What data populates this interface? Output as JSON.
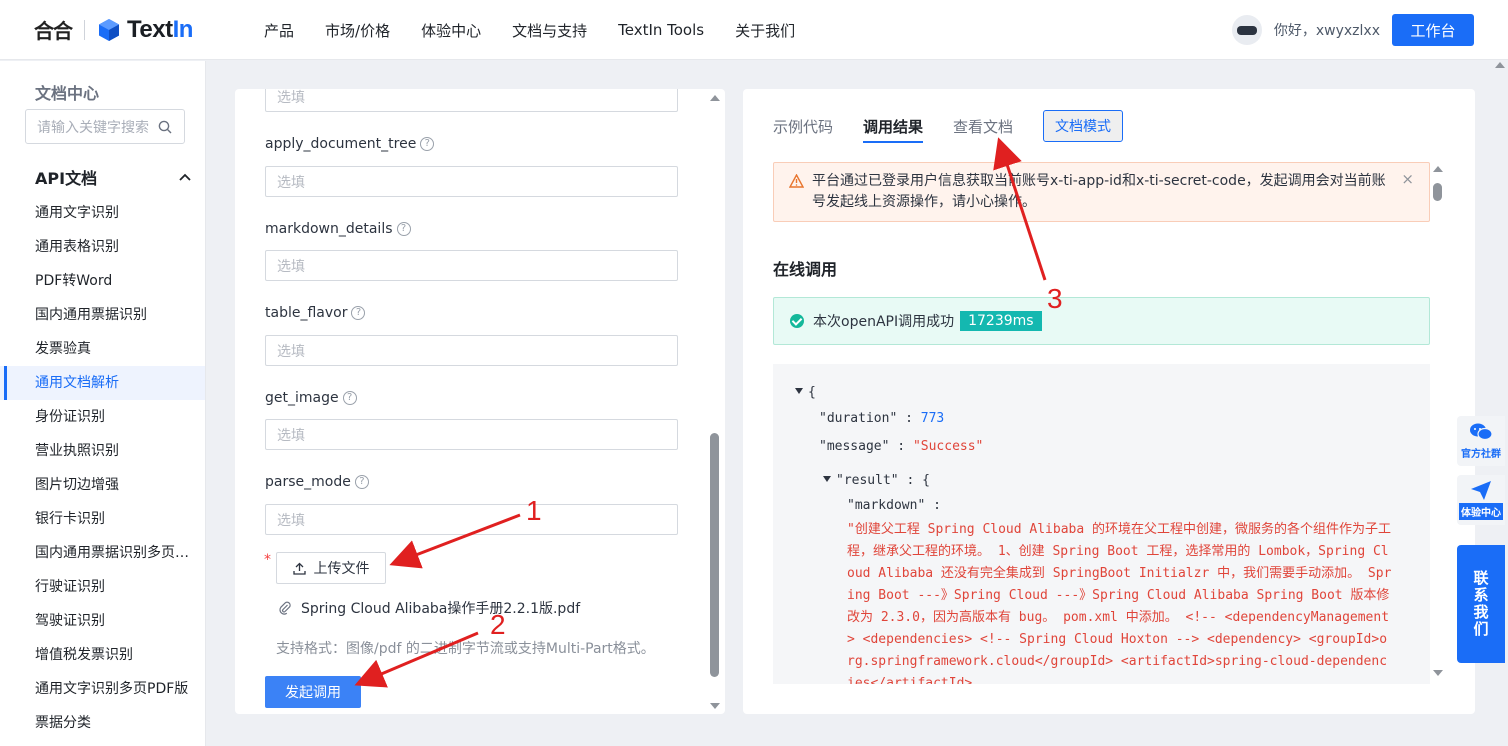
{
  "header": {
    "logo_he": "合合",
    "logo_text_a": "Text",
    "logo_text_b": "In",
    "nav": [
      "产品",
      "市场/价格",
      "体验中心",
      "文档与支持",
      "TextIn Tools",
      "关于我们"
    ],
    "greeting": "你好，xwyxzlxx",
    "workbench_label": "工作台"
  },
  "sidebar": {
    "title": "文档中心",
    "search_placeholder": "请输入关键字搜索",
    "section": "API文档",
    "items": [
      "通用文字识别",
      "通用表格识别",
      "PDF转Word",
      "国内通用票据识别",
      "发票验真",
      "通用文档解析",
      "身份证识别",
      "营业执照识别",
      "图片切边增强",
      "银行卡识别",
      "国内通用票据识别多页…",
      "行驶证识别",
      "驾驶证识别",
      "增值税发票识别",
      "通用文字识别多页PDF版",
      "票据分类"
    ],
    "active_index": 5
  },
  "form": {
    "placeholder": "选填",
    "fields": [
      "apply_document_tree",
      "markdown_details",
      "table_flavor",
      "get_image",
      "parse_mode"
    ],
    "upload_label": "上传文件",
    "file_name": "Spring Cloud Alibaba操作手册2.2.1版.pdf",
    "format_hint": "支持格式：图像/pdf 的二进制字节流或支持Multi-Part格式。",
    "invoke_label": "发起调用",
    "required_mark": "*"
  },
  "result": {
    "tabs": [
      "示例代码",
      "调用结果",
      "查看文档"
    ],
    "active_tab": 1,
    "doc_mode_label": "文档模式",
    "warning": "平台通过已登录用户信息获取当前账号x-ti-app-id和x-ti-secret-code，发起调用会对当前账号发起线上资源操作，请小心操作。",
    "warning_close": "×",
    "online_title": "在线调用",
    "success_text": "本次openAPI调用成功",
    "timing": "17239ms",
    "json": {
      "open_brace": "{",
      "duration_key": "\"duration\"",
      "duration_val": "773",
      "message_key": "\"message\"",
      "message_val": "\"Success\"",
      "result_key": "\"result\"",
      "result_open": "{",
      "markdown_key": "\"markdown\"",
      "colon": " : ",
      "markdown_val": "\"创建父工程 Spring Cloud Alibaba 的环境在父工程中创建，微服务的各个组件作为子工程，继承父工程的环境。 1、创建 Spring Boot 工程，选择常用的 Lombok，Spring Cloud Alibaba 还没有完全集成到 SpringBoot Initialzr 中，我们需要手动添加。 Spring Boot ---》Spring Cloud ---》Spring Cloud Alibaba Spring Boot 版本修改为 2.3.0，因为高版本有 bug。 pom.xml 中添加。 <!-- <dependencyManagement> <dependencies> <!-- Spring Cloud Hoxton --> <dependency> <groupId>org.springframework.cloud</groupId> <artifactId>spring-cloud-dependencies</artifactId>"
    }
  },
  "floating": {
    "community": "官方社群",
    "experience": "体验中心",
    "contact": "联系我们"
  },
  "annotations": [
    "1",
    "2",
    "3"
  ],
  "colors": {
    "accent": "#1a6df7",
    "annotation": "#e02020",
    "success": "#14b89a",
    "json_string": "#e0453a"
  }
}
